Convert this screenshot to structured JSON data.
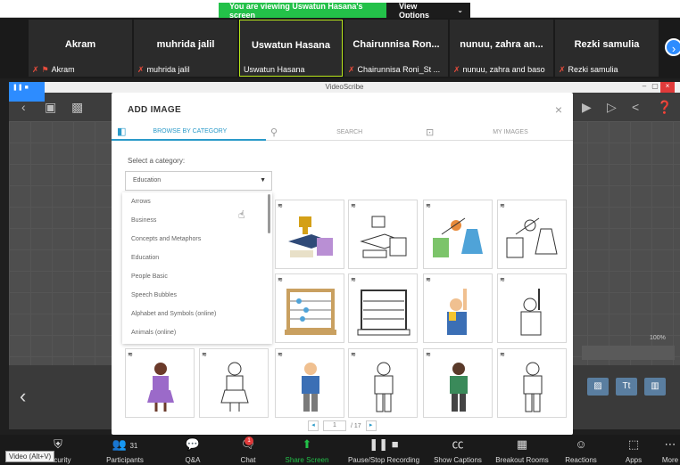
{
  "banner": {
    "message": "You are viewing Uswatun Hasana's screen",
    "view_options": "View Options",
    "caret": "⌄"
  },
  "gallery": {
    "tiles": [
      {
        "name": "Akram",
        "label": "Akram"
      },
      {
        "name": "muhrida jalil",
        "label": "muhrida jalil"
      },
      {
        "name": "Uswatun Hasana",
        "label": "Uswatun Hasana"
      },
      {
        "name": "Chairunnisa  Ron...",
        "label": "Chairunnisa Roni_St ..."
      },
      {
        "name": "nunuu, zahra an...",
        "label": "nunuu, zahra and baso"
      },
      {
        "name": "Rezki samulia",
        "label": "Rezki samulia"
      }
    ]
  },
  "videoscribe": {
    "title": "VideoScribe",
    "zoom": "100%",
    "tt": "Tt"
  },
  "modal": {
    "title": "ADD IMAGE",
    "close": "×",
    "tabs": {
      "browse": "BROWSE BY CATEGORY",
      "search": "SEARCH",
      "my_images": "MY IMAGES"
    },
    "select_label": "Select a category:",
    "selected": "Education",
    "categories": [
      "Arrows",
      "Business",
      "Concepts and Metaphors",
      "Education",
      "People Basic",
      "Speech Bubbles",
      "Alphabet and Symbols (online)",
      "Animals (online)"
    ],
    "pager": {
      "page": "1",
      "total": "/ 17",
      "prev": "◂",
      "next": "▸"
    }
  },
  "toolbar": {
    "participants_count": "31",
    "items": [
      "Security",
      "Participants",
      "Q&A",
      "Chat",
      "Share Screen",
      "Pause/Stop Recording",
      "Show Captions",
      "Breakout Rooms",
      "Reactions",
      "Apps",
      "More"
    ],
    "chat_badge": "1"
  },
  "tooltip": "Video (Alt+V)"
}
